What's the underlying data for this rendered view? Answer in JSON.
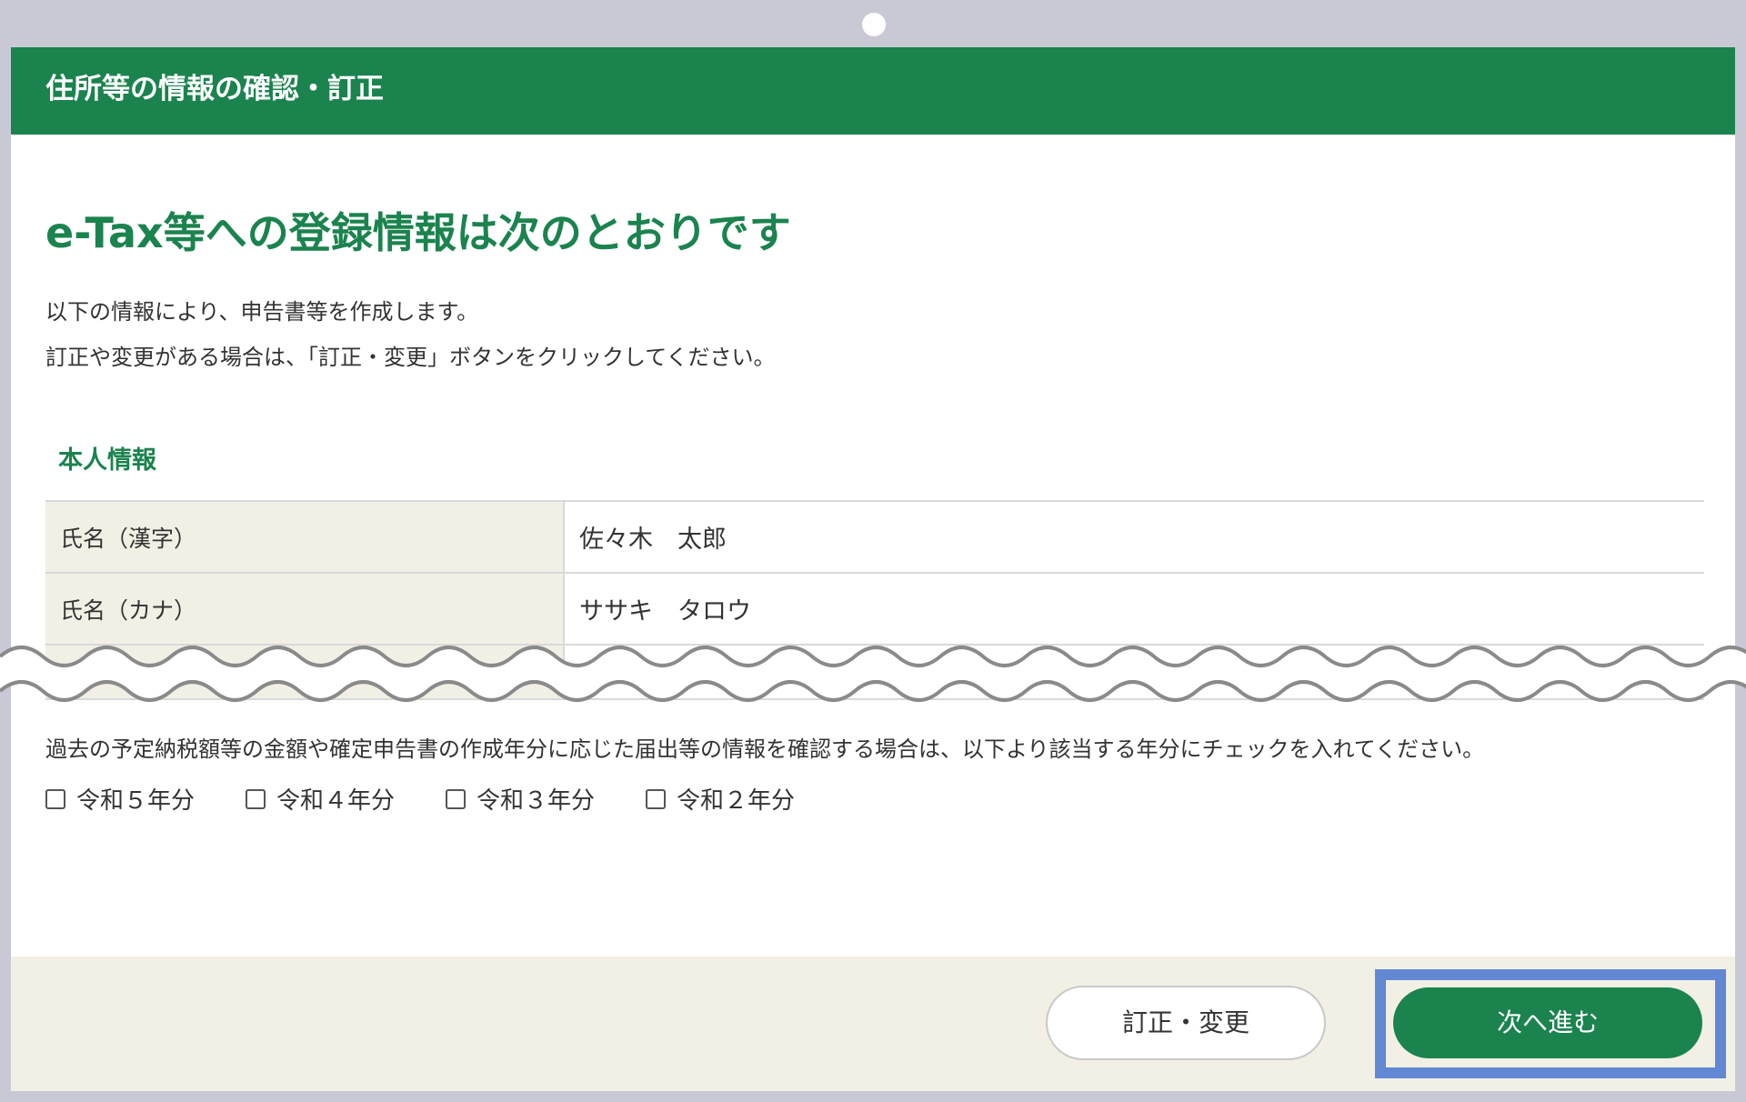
{
  "header": {
    "title": "住所等の情報の確認・訂正"
  },
  "main": {
    "headline": "e-Tax等への登録情報は次のとおりです",
    "description": [
      "以下の情報により、申告書等を作成します。",
      "訂正や変更がある場合は、「訂正・変更」ボタンをクリックしてください。"
    ],
    "personal_info": {
      "title": "本人情報",
      "rows": [
        {
          "label": "氏名（漢字）",
          "value": "佐々木　太郎"
        },
        {
          "label": "氏名（カナ）",
          "value": "ササキ　タロウ"
        }
      ]
    },
    "notice": "過去の予定納税額等の金額や確定申告書の作成年分に応じた届出等の情報を確認する場合は、以下より該当する年分にチェックを入れてください。",
    "year_checks": [
      {
        "label": "令和５年分",
        "checked": false
      },
      {
        "label": "令和４年分",
        "checked": false
      },
      {
        "label": "令和３年分",
        "checked": false
      },
      {
        "label": "令和２年分",
        "checked": false
      }
    ]
  },
  "footer": {
    "correct_button": "訂正・変更",
    "next_button": "次へ進む"
  },
  "colors": {
    "brand_green": "#1b834e",
    "highlight_blue": "#6288d4",
    "label_bg": "#f2f0e5",
    "frame": "#c9c9d6"
  }
}
